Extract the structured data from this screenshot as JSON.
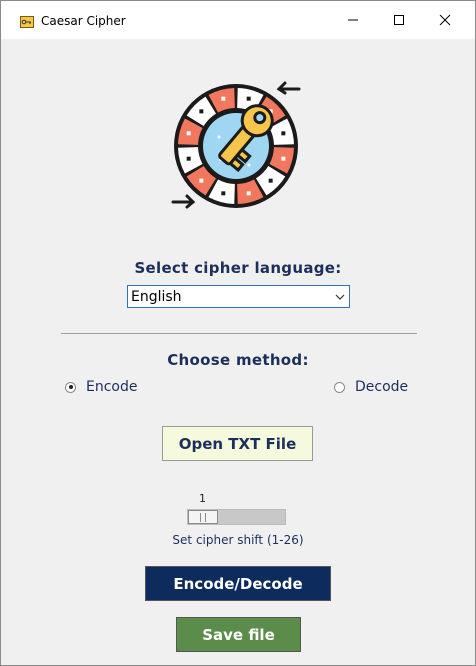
{
  "window": {
    "title": "Caesar Cipher",
    "icon": "key-icon"
  },
  "language": {
    "label": "Select cipher language:",
    "selected": "English"
  },
  "method": {
    "label": "Choose method:",
    "options": [
      {
        "label": "Encode",
        "checked": true
      },
      {
        "label": "Decode",
        "checked": false
      }
    ]
  },
  "open_button": "Open TXT File",
  "shift": {
    "value": "1",
    "label": "Set cipher shift (1-26)"
  },
  "encode_decode_button": "Encode/Decode",
  "save_button": "Save file",
  "colors": {
    "accent_navy": "#0d2b5c",
    "save_green": "#5b8c4a",
    "label_navy": "#1c2f5b",
    "open_button_bg": "#f5fadf"
  }
}
